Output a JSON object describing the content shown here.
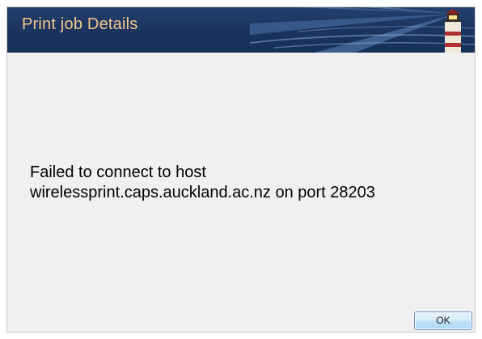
{
  "window": {
    "title": "Print job Details"
  },
  "message": {
    "line1": "Failed to connect to host",
    "line2": "wirelessprint.caps.auckland.ac.nz on port 28203"
  },
  "buttons": {
    "ok_label": "OK"
  },
  "colors": {
    "header_bg": "#1c3560",
    "title_text": "#f4c890",
    "body_bg": "#f0f0f0"
  },
  "icons": {
    "header_art": "lighthouse-icon"
  }
}
